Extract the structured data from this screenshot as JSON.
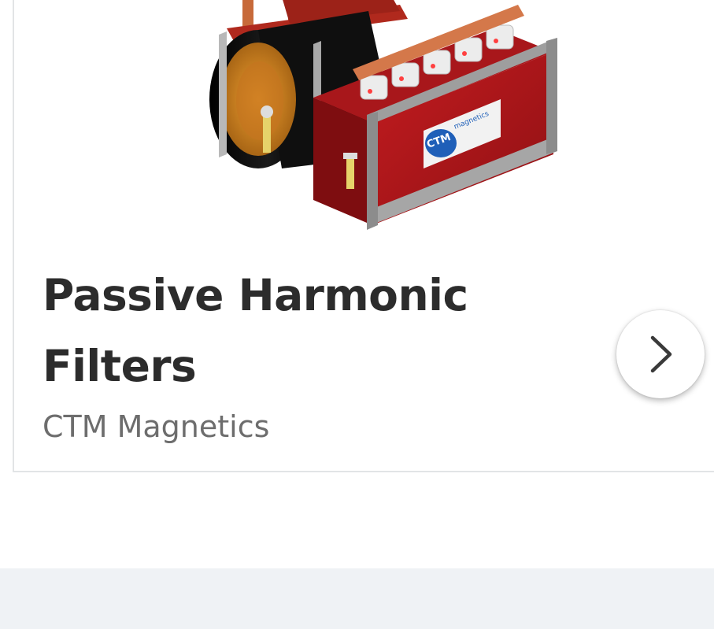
{
  "card": {
    "title": "Passive Harmonic Filters",
    "subtitle": "CTM Magnetics",
    "image_logo_text": "CTM",
    "image_logo_sub": "magnetics"
  },
  "icons": {
    "next": "chevron-right-icon"
  },
  "colors": {
    "title": "#2c2c2c",
    "subtitle": "#6d6d6d",
    "footer_band": "#eff2f5",
    "card_border": "#e2e4e6",
    "enclosure_red": "#b3161a",
    "logo_blue": "#1f5fb8"
  }
}
